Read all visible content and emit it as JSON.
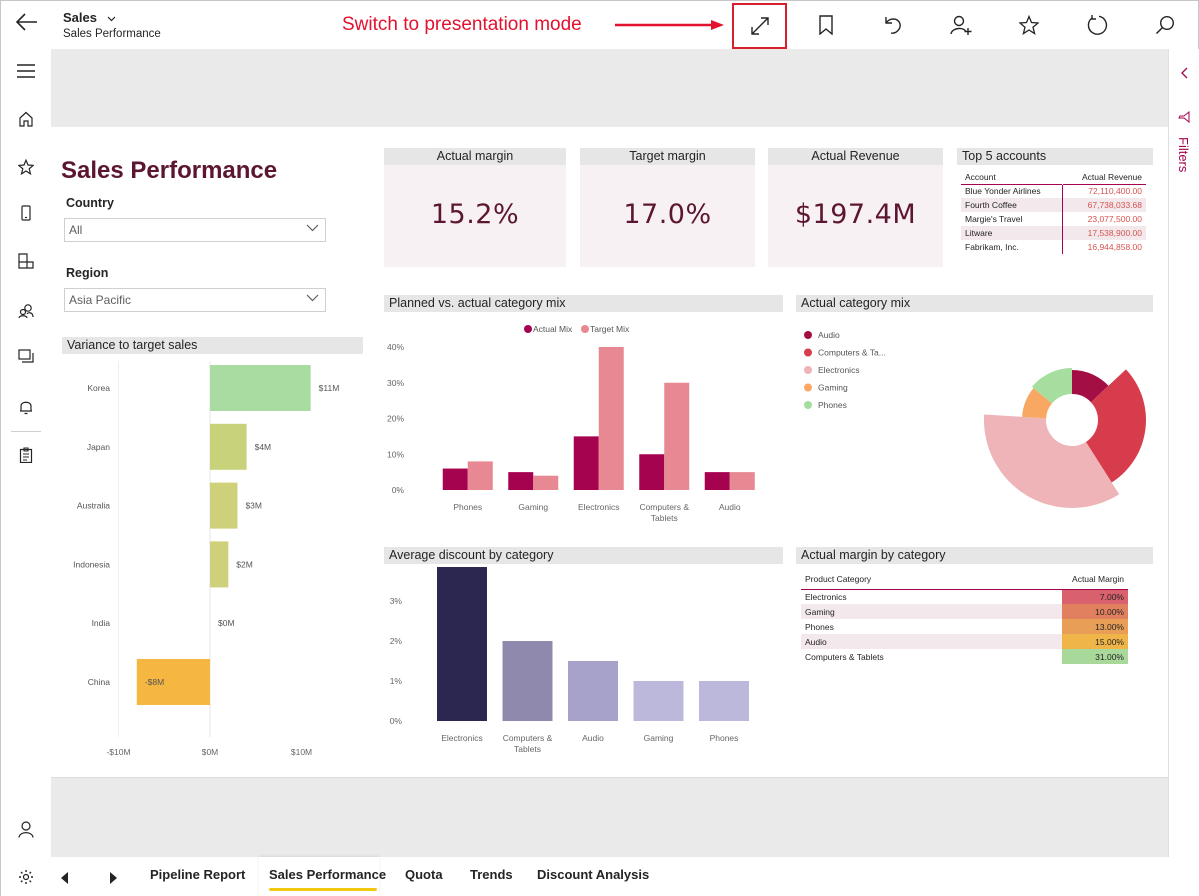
{
  "header": {
    "title": "Sales",
    "subtitle": "Sales Performance"
  },
  "annotation": {
    "text": "Switch to presentation mode",
    "color": "#e3122e"
  },
  "toolbar": [
    "expand-icon",
    "bookmark-icon",
    "undo-icon",
    "add-person-icon",
    "star-icon",
    "refresh-icon",
    "search-icon"
  ],
  "leftnav": [
    "hamburger-icon",
    "home-icon",
    "star-icon",
    "mobile-icon",
    "workspace-icon",
    "shared-icon",
    "apps-icon",
    "notification-icon",
    "clipboard-icon"
  ],
  "rightpane": {
    "filters_label": "Filters"
  },
  "report": {
    "title": "Sales Performance",
    "country": {
      "label": "Country",
      "value": "All"
    },
    "region": {
      "label": "Region",
      "value": "Asia Pacific"
    },
    "kpis": [
      {
        "title": "Actual margin",
        "value": "15.2%"
      },
      {
        "title": "Target margin",
        "value": "17.0%"
      },
      {
        "title": "Actual Revenue",
        "value": "$197.4M"
      }
    ],
    "top_accounts": {
      "title": "Top 5 accounts",
      "headers": [
        "Account",
        "Actual Revenue"
      ],
      "rows": [
        [
          "Blue Yonder Airlines",
          "72,110,400.00"
        ],
        [
          "Fourth Coffee",
          "67,738,033.68"
        ],
        [
          "Margie's Travel",
          "23,077,500.00"
        ],
        [
          "Litware",
          "17,538,900.00"
        ],
        [
          "Fabrikam, Inc.",
          "16,944,858.00"
        ]
      ]
    },
    "margin_table": {
      "title": "Actual margin by category",
      "headers": [
        "Product Category",
        "Actual Margin"
      ],
      "rows": [
        [
          "Electronics",
          "7.00%"
        ],
        [
          "Gaming",
          "10.00%"
        ],
        [
          "Phones",
          "13.00%"
        ],
        [
          "Audio",
          "15.00%"
        ],
        [
          "Computers & Tablets",
          "31.00%"
        ]
      ],
      "colors": [
        "#d8616d",
        "#e0805f",
        "#e89e56",
        "#f0b549",
        "#a8d99b"
      ]
    }
  },
  "tabs": [
    "Pipeline Report",
    "Sales Performance",
    "Quota",
    "Trends",
    "Discount Analysis"
  ],
  "active_tab": "Sales Performance",
  "tab_accent": "#f2c811",
  "chart_data": [
    {
      "type": "bar",
      "orientation": "horizontal",
      "title": "Variance to target sales",
      "categories": [
        "Korea",
        "Japan",
        "Australia",
        "Indonesia",
        "India",
        "China"
      ],
      "values": [
        11,
        4,
        3,
        2,
        0,
        -8
      ],
      "labels": [
        "$11M",
        "$4M",
        "$3M",
        "$2M",
        "$0M",
        "-$8M"
      ],
      "colors": [
        "#a8dca0",
        "#c8d27a",
        "#ced07a",
        "#ced07a",
        "#ced07a",
        "#f5b642"
      ],
      "xticks": [
        "-$10M",
        "$0M",
        "$10M"
      ],
      "xlim": [
        -10,
        11
      ]
    },
    {
      "type": "bar",
      "title": "Planned vs. actual category mix",
      "categories": [
        "Phones",
        "Gaming",
        "Electronics",
        "Computers & Tablets",
        "Audio"
      ],
      "series": [
        {
          "name": "Actual Mix",
          "values": [
            6,
            5,
            15,
            10,
            5
          ],
          "color": "#a5034f"
        },
        {
          "name": "Target Mix",
          "values": [
            8,
            4,
            40,
            30,
            5
          ],
          "color": "#e88892"
        }
      ],
      "yticks": [
        "0%",
        "10%",
        "20%",
        "30%",
        "40%"
      ],
      "ylim": [
        0,
        40
      ],
      "legend": "top"
    },
    {
      "type": "pie",
      "title": "Actual category mix",
      "categories": [
        "Audio",
        "Computers & Ta...",
        "Electronics",
        "Gaming",
        "Phones"
      ],
      "values": [
        13,
        28,
        35,
        10,
        14
      ],
      "colors": [
        "#a30f45",
        "#d63c4c",
        "#eeb4b8",
        "#f8a862",
        "#a6dea0"
      ],
      "legend": "left"
    },
    {
      "type": "bar",
      "title": "Average discount by category",
      "categories": [
        "Electronics",
        "Computers & Tablets",
        "Audio",
        "Gaming",
        "Phones"
      ],
      "values": [
        4,
        2,
        1.5,
        1,
        1
      ],
      "colors": [
        "#2c2750",
        "#8f8aad",
        "#a7a2c9",
        "#bcb8dc",
        "#bcb8dc"
      ],
      "yticks": [
        "0%",
        "1%",
        "2%",
        "3%",
        "4%"
      ],
      "ylim": [
        0,
        4
      ]
    }
  ]
}
